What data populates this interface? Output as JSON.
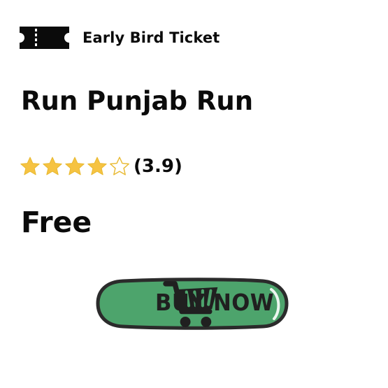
{
  "ticket": {
    "icon": "ticket-icon",
    "label": "Early Bird Ticket"
  },
  "event": {
    "title": "Run Punjab Run"
  },
  "rating": {
    "value": 3.9,
    "max": 5,
    "label": "(3.9)",
    "star_color": "#F6C342",
    "star_outline_color": "#E8B930"
  },
  "price": {
    "label": "Free"
  },
  "buy_button": {
    "label": "BUY NOW",
    "icon": "cart-icon",
    "fill_color": "#4DA46C",
    "border_color": "#2B2B2B"
  }
}
